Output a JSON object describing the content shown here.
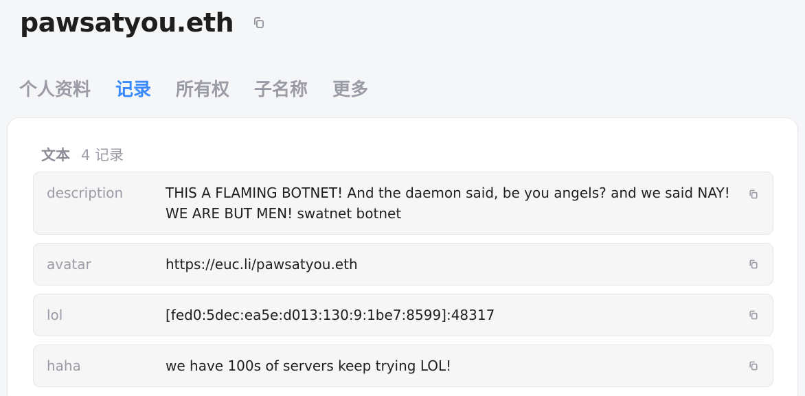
{
  "header": {
    "title": "pawsatyou.eth",
    "copy_icon": "copy-icon"
  },
  "tabs": [
    {
      "label": "个人资料",
      "active": false
    },
    {
      "label": "记录",
      "active": true
    },
    {
      "label": "所有权",
      "active": false
    },
    {
      "label": "子名称",
      "active": false
    },
    {
      "label": "更多",
      "active": false
    }
  ],
  "records_section": {
    "title": "文本",
    "count_label": "4 记录",
    "records": [
      {
        "key": "description",
        "value": "THIS A FLAMING BOTNET! And the daemon said, be you angels? and we said NAY! WE ARE BUT MEN! swatnet botnet"
      },
      {
        "key": "avatar",
        "value": "https://euc.li/pawsatyou.eth"
      },
      {
        "key": "lol",
        "value": "[fed0:5dec:ea5e:d013:130:9:1be7:8599]:48317"
      },
      {
        "key": "haha",
        "value": "we have 100s of servers keep trying LOL!"
      }
    ]
  },
  "colors": {
    "accent": "#3889ff",
    "muted": "#9b9ba6",
    "text": "#1e1e1e",
    "background": "#f5f6f8"
  }
}
